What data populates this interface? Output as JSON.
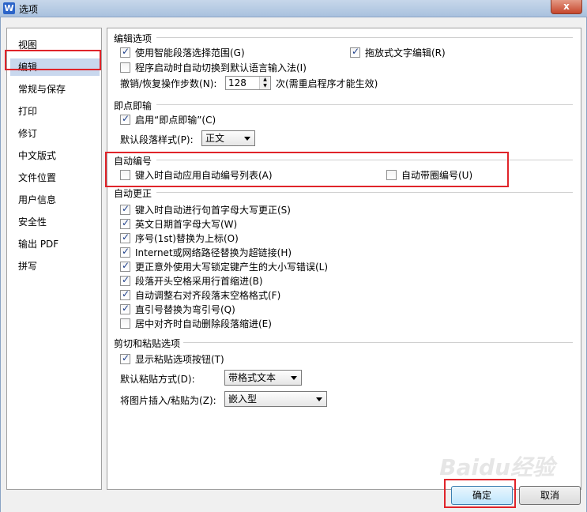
{
  "window": {
    "title": "选项",
    "close_label": "x",
    "app_logo": "W"
  },
  "sidebar": {
    "items": [
      {
        "label": "视图"
      },
      {
        "label": "编辑"
      },
      {
        "label": "常规与保存"
      },
      {
        "label": "打印"
      },
      {
        "label": "修订"
      },
      {
        "label": "中文版式"
      },
      {
        "label": "文件位置"
      },
      {
        "label": "用户信息"
      },
      {
        "label": "安全性"
      },
      {
        "label": "输出 PDF"
      },
      {
        "label": "拼写"
      }
    ],
    "selected": "编辑"
  },
  "edit_options": {
    "title": "编辑选项",
    "smart_select": {
      "label": "使用智能段落选择范围(G)",
      "checked": true
    },
    "drag_drop": {
      "label": "拖放式文字编辑(R)",
      "checked": true
    },
    "auto_ime": {
      "label": "程序启动时自动切换到默认语言输入法(I)",
      "checked": false
    },
    "undo_label": "撤销/恢复操作步数(N):",
    "undo_value": "128",
    "undo_note": "次(需重启程序才能生效)"
  },
  "click_type": {
    "title": "即点即输",
    "enable": {
      "label": "启用“即点即输”(C)",
      "checked": true
    },
    "style_label": "默认段落样式(P):",
    "style_value": "正文"
  },
  "auto_number": {
    "title": "自动编号",
    "auto_list": {
      "label": "键入时自动应用自动编号列表(A)",
      "checked": false
    },
    "circle_number": {
      "label": "自动带圈编号(U)",
      "checked": false
    }
  },
  "auto_correct": {
    "title": "自动更正",
    "items": [
      {
        "label": "键入时自动进行句首字母大写更正(S)",
        "checked": true
      },
      {
        "label": "英文日期首字母大写(W)",
        "checked": true
      },
      {
        "label": "序号(1st)替换为上标(O)",
        "checked": true
      },
      {
        "label": "Internet或网络路径替换为超链接(H)",
        "checked": true
      },
      {
        "label": "更正意外使用大写锁定键产生的大小写错误(L)",
        "checked": true
      },
      {
        "label": "段落开头空格采用行首缩进(B)",
        "checked": true
      },
      {
        "label": "自动调整右对齐段落末空格格式(F)",
        "checked": true
      },
      {
        "label": "直引号替换为弯引号(Q)",
        "checked": true
      },
      {
        "label": "居中对齐时自动删除段落缩进(E)",
        "checked": false
      }
    ]
  },
  "paste": {
    "title": "剪切和粘贴选项",
    "show_button": {
      "label": "显示粘贴选项按钮(T)",
      "checked": true
    },
    "mode_label": "默认粘贴方式(D):",
    "mode_value": "带格式文本",
    "picture_label": "将图片插入/粘贴为(Z):",
    "picture_value": "嵌入型"
  },
  "buttons": {
    "ok": "确定",
    "cancel": "取消"
  },
  "watermark": "Baidu经验",
  "colors": {
    "highlight": "#e0242a",
    "selected_bg": "#c9d8ee"
  }
}
